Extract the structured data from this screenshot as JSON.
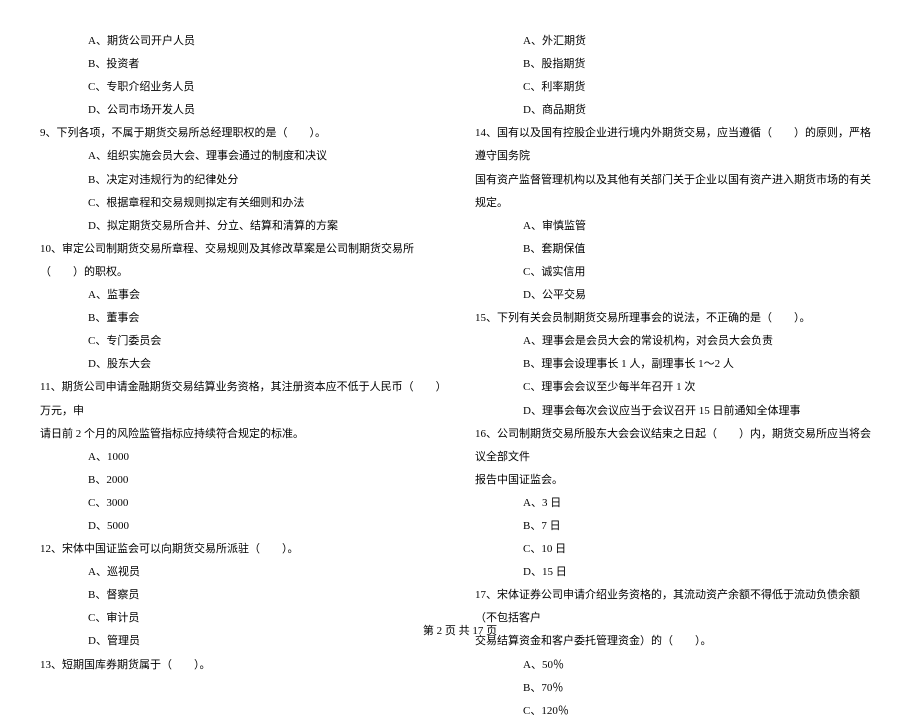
{
  "left": {
    "opts_pre": [
      "A、期货公司开户人员",
      "B、投资者",
      "C、专职介绍业务人员",
      "D、公司市场开发人员"
    ],
    "q9": "9、下列各项，不属于期货交易所总经理职权的是（　　）。",
    "q9_opts": [
      "A、组织实施会员大会、理事会通过的制度和决议",
      "B、决定对违规行为的纪律处分",
      "C、根据章程和交易规则拟定有关细则和办法",
      "D、拟定期货交易所合并、分立、结算和清算的方案"
    ],
    "q10": "10、审定公司制期货交易所章程、交易规则及其修改草案是公司制期货交易所（　　）的职权。",
    "q10_opts": [
      "A、监事会",
      "B、董事会",
      "C、专门委员会",
      "D、股东大会"
    ],
    "q11": "11、期货公司申请金融期货交易结算业务资格，其注册资本应不低于人民币（　　）万元，申",
    "q11_cont": "请日前 2 个月的风险监管指标应持续符合规定的标准。",
    "q11_opts": [
      "A、1000",
      "B、2000",
      "C、3000",
      "D、5000"
    ],
    "q12": "12、宋体中国证监会可以向期货交易所派驻（　　）。",
    "q12_opts": [
      "A、巡视员",
      "B、督察员",
      "C、审计员",
      "D、管理员"
    ],
    "q13": "13、短期国库券期货属于（　　）。"
  },
  "right": {
    "opts_pre": [
      "A、外汇期货",
      "B、股指期货",
      "C、利率期货",
      "D、商品期货"
    ],
    "q14": "14、国有以及国有控股企业进行境内外期货交易，应当遵循（　　）的原则，严格遵守国务院",
    "q14_cont": "国有资产监督管理机构以及其他有关部门关于企业以国有资产进入期货市场的有关规定。",
    "q14_opts": [
      "A、审慎监管",
      "B、套期保值",
      "C、诚实信用",
      "D、公平交易"
    ],
    "q15": "15、下列有关会员制期货交易所理事会的说法，不正确的是（　　）。",
    "q15_opts": [
      "A、理事会是会员大会的常设机构，对会员大会负责",
      "B、理事会设理事长 1 人，副理事长 1～2 人",
      "C、理事会会议至少每半年召开 1 次",
      "D、理事会每次会议应当于会议召开 15 日前通知全体理事"
    ],
    "q16": "16、公司制期货交易所股东大会会议结束之日起（　　）内，期货交易所应当将会议全部文件",
    "q16_cont": "报告中国证监会。",
    "q16_opts": [
      "A、3 日",
      "B、7 日",
      "C、10 日",
      "D、15 日"
    ],
    "q17": "17、宋体证券公司申请介绍业务资格的，其流动资产余额不得低于流动负债余额（不包括客户",
    "q17_cont": "交易结算资金和客户委托管理资金）的（　　）。",
    "q17_opts": [
      "A、50％",
      "B、70％",
      "C、120％"
    ]
  },
  "footer": "第 2 页 共 17 页"
}
